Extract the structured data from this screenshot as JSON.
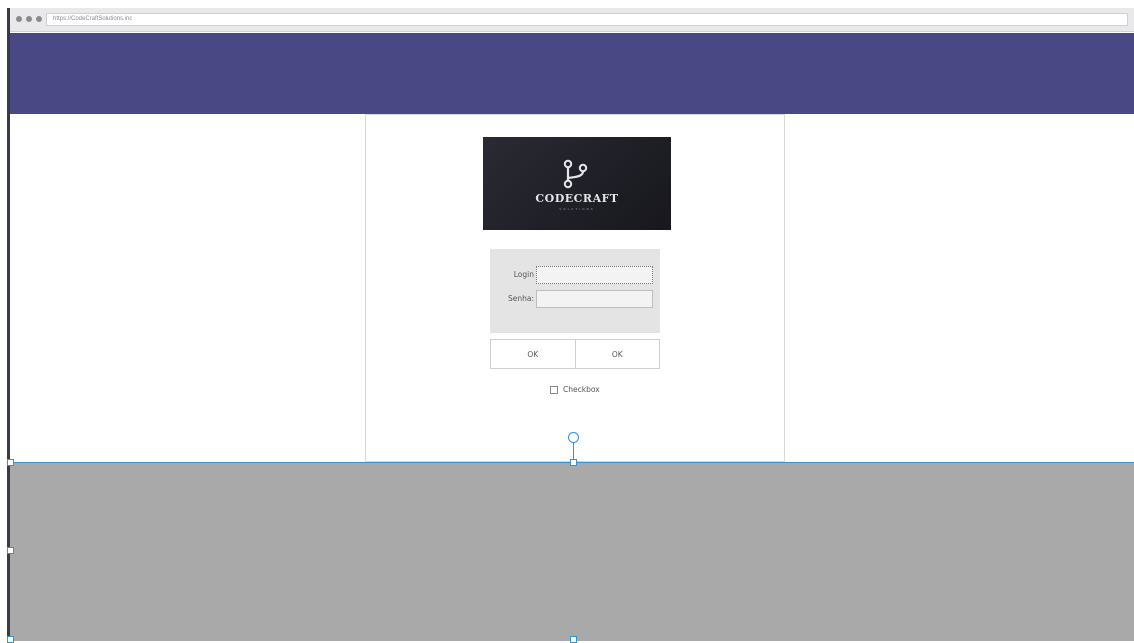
{
  "browser": {
    "url": "https://CodeCraftSolutions.inc"
  },
  "logo": {
    "name": "CODECRAFT",
    "tagline": "SOLUTIONS"
  },
  "login_form": {
    "login_label": "Login",
    "login_value": "",
    "password_label": "Senha:",
    "password_value": "",
    "ok_button_1": "OK",
    "ok_button_2": "OK",
    "checkbox_label": "Checkbox",
    "checkbox_checked": false
  },
  "colors": {
    "header": "#4a4785",
    "footer": "#a9a9a9",
    "selection": "#2f95d8"
  }
}
